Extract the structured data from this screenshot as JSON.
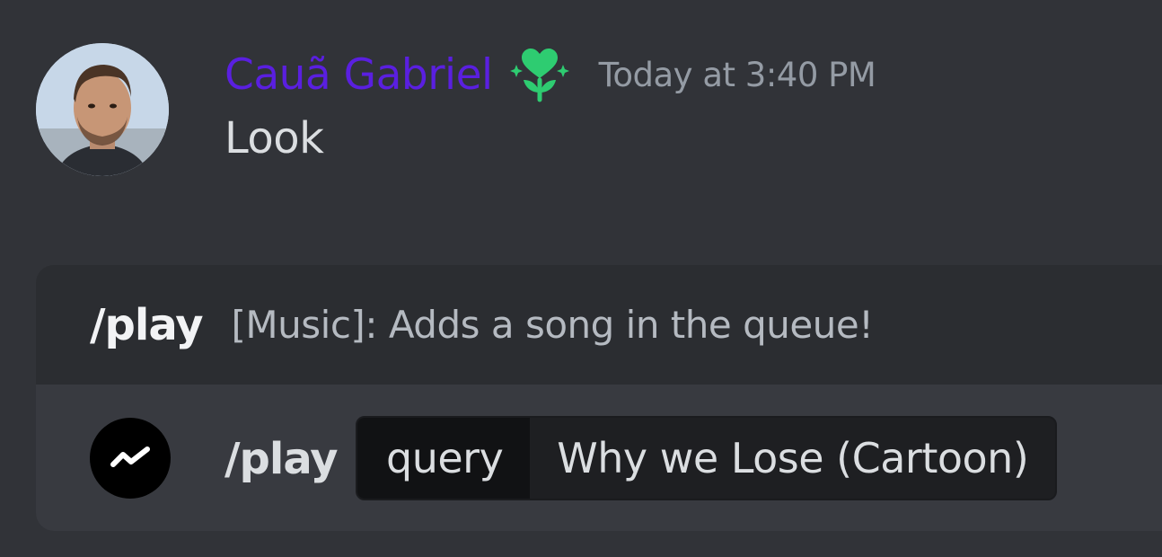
{
  "colors": {
    "background": "#313338",
    "autocomplete_background": "#2b2d31",
    "option_background": "#383a40",
    "username": "#5a1fe0",
    "role_icon": "#2ecc71",
    "timestamp": "#949ba4",
    "message_text": "#dbdee1",
    "command_text": "#f2f3f5",
    "description_text": "#b5bac1",
    "param_name_text": "#dbdee1",
    "param_value_text": "#dbdee1",
    "option_command_text": "#dbdee1"
  },
  "message": {
    "username": "Cauã Gabriel",
    "role_icon": "heart-plant-icon",
    "timestamp": "Today at 3:40 PM",
    "content": "Look"
  },
  "autocomplete": {
    "header_command": "/play",
    "header_description": "[Music]: Adds a song in the queue!",
    "option": {
      "app_icon": "wave-icon",
      "command": "/play",
      "param_name": "query",
      "param_value": "Why we Lose (Cartoon)"
    }
  }
}
